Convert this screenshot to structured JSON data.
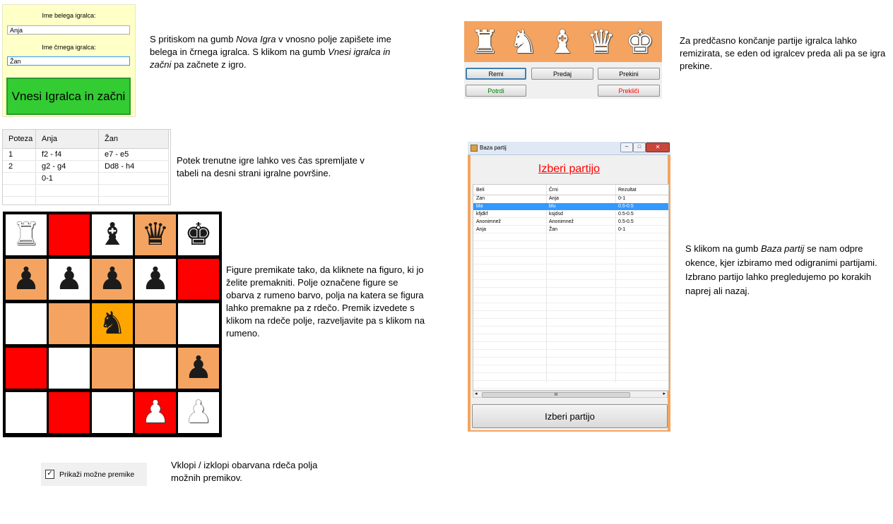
{
  "player_setup": {
    "white_label": "Ime belega igralca:",
    "white_value": "Anja",
    "black_label": "Ime črnega igralca:",
    "black_value": "Žan",
    "start_button": "Vnesi Igralca in začni",
    "description": [
      {
        "text": "S pritiskom na gumb ",
        "italic": false
      },
      {
        "text": "Nova Igra",
        "italic": true
      },
      {
        "text": " v vnosno polje zapišete ime belega in črnega igralca. S klikom na gumb ",
        "italic": false
      },
      {
        "text": "Vnesi igralca in začni",
        "italic": true
      },
      {
        "text": " pa začnete z igro.",
        "italic": false
      }
    ]
  },
  "moves_table": {
    "headers": [
      "Poteza",
      "Anja",
      "Žan"
    ],
    "rows": [
      [
        "1",
        "f2 - f4",
        "e7 - e5"
      ],
      [
        "2",
        "g2 - g4",
        "Dd8 - h4"
      ],
      [
        "",
        "0-1",
        ""
      ],
      [
        "",
        "",
        ""
      ],
      [
        "",
        "",
        ""
      ]
    ],
    "description": "Potek trenutne igre lahko ves čas spremljate v tabeli na desni strani igralne površine."
  },
  "board": {
    "colors": {
      "red": "#ff0000",
      "orange": "#f4a460",
      "white": "#ffffff",
      "highlight": "#ffa500"
    },
    "squares": [
      [
        {
          "bg": "white",
          "piece": "rook",
          "icon": "rook-icon",
          "side": "w"
        },
        {
          "bg": "red",
          "piece": "",
          "side": ""
        },
        {
          "bg": "white",
          "piece": "bishop",
          "icon": "bishop-icon",
          "side": "b"
        },
        {
          "bg": "orange",
          "piece": "queen",
          "icon": "queen-icon",
          "side": "b"
        },
        {
          "bg": "white",
          "piece": "king",
          "icon": "king-icon",
          "side": "b"
        }
      ],
      [
        {
          "bg": "orange",
          "piece": "pawn",
          "icon": "pawn-icon",
          "side": "b"
        },
        {
          "bg": "white",
          "piece": "pawn",
          "icon": "pawn-icon",
          "side": "b"
        },
        {
          "bg": "orange",
          "piece": "pawn",
          "icon": "pawn-icon",
          "side": "b"
        },
        {
          "bg": "white",
          "piece": "pawn",
          "icon": "pawn-icon",
          "side": "b"
        },
        {
          "bg": "red",
          "piece": "",
          "side": ""
        }
      ],
      [
        {
          "bg": "white",
          "piece": "",
          "side": ""
        },
        {
          "bg": "orange",
          "piece": "",
          "side": ""
        },
        {
          "bg": "highlight",
          "piece": "knight",
          "icon": "knight-icon",
          "side": "b"
        },
        {
          "bg": "orange",
          "piece": "",
          "side": ""
        },
        {
          "bg": "white",
          "piece": "",
          "side": ""
        }
      ],
      [
        {
          "bg": "red",
          "piece": "",
          "side": ""
        },
        {
          "bg": "white",
          "piece": "",
          "side": ""
        },
        {
          "bg": "orange",
          "piece": "",
          "side": ""
        },
        {
          "bg": "white",
          "piece": "",
          "side": ""
        },
        {
          "bg": "orange",
          "piece": "pawn",
          "icon": "pawn-icon",
          "side": "b"
        }
      ],
      [
        {
          "bg": "white",
          "piece": "",
          "side": ""
        },
        {
          "bg": "red",
          "piece": "",
          "side": ""
        },
        {
          "bg": "white",
          "piece": "",
          "side": ""
        },
        {
          "bg": "red",
          "piece": "pawn",
          "icon": "pawn-icon",
          "side": "w"
        },
        {
          "bg": "white",
          "piece": "pawn",
          "icon": "pawn-icon",
          "side": "w"
        }
      ]
    ],
    "description": "Figure premikate tako, da kliknete na figuro, ki jo želite premakniti. Polje označene figure se obarva z rumeno barvo, polja na katera se figura lahko premakne pa z rdečo. Premik izvedete s klikom na rdeče polje, razveljavite pa s klikom na rumeno."
  },
  "show_moves": {
    "label": "Prikaži možne premike",
    "checked": true,
    "description": "Vklopi / izklopi obarvana rdeča polja možnih premikov."
  },
  "game_end": {
    "pieces": [
      {
        "piece": "rook",
        "icon": "rook-icon"
      },
      {
        "piece": "knight",
        "icon": "knight-icon"
      },
      {
        "piece": "bishop",
        "icon": "bishop-icon"
      },
      {
        "piece": "queen",
        "icon": "queen-icon"
      },
      {
        "piece": "king",
        "icon": "king-icon"
      }
    ],
    "buttons": {
      "draw": "Remi",
      "resign": "Predaj",
      "abort": "Prekini",
      "confirm": "Potrdi",
      "cancel": "Prekliči"
    },
    "confirm_color": "#008000",
    "cancel_color": "#ff0000",
    "description": "Za predčasno končanje partije igralca lahko remizirata, se eden od igralcev preda ali pa se igra prekine."
  },
  "database": {
    "window_title": "Baza partij",
    "heading": "Izberi partijo",
    "heading_color": "#ff0000",
    "columns": [
      "Beli",
      "Črni",
      "Rezultat"
    ],
    "rows": [
      [
        "Zan",
        "Anja",
        "0-1"
      ],
      [
        "bla",
        "blu",
        "0.5-0.5"
      ],
      [
        "kfjdkf",
        "ksjdsd",
        "0.5-0.5"
      ],
      [
        "Anonimnež",
        "Anonimnež",
        "0.5-0.5"
      ],
      [
        "Anja",
        "Žan",
        "0-1"
      ]
    ],
    "selected_row": 1,
    "selected_color": "#3399ff",
    "choose_button": "Izberi partijo",
    "scroll_thumb": "III",
    "description": [
      {
        "text": "S klikom na gumb ",
        "italic": false
      },
      {
        "text": "Baza partij",
        "italic": true
      },
      {
        "text": " se nam odpre okence, kjer izbiramo med odigranimi partijami. Izbrano partijo lahko pregledujemo po korakih naprej ali nazaj.",
        "italic": false
      }
    ]
  }
}
